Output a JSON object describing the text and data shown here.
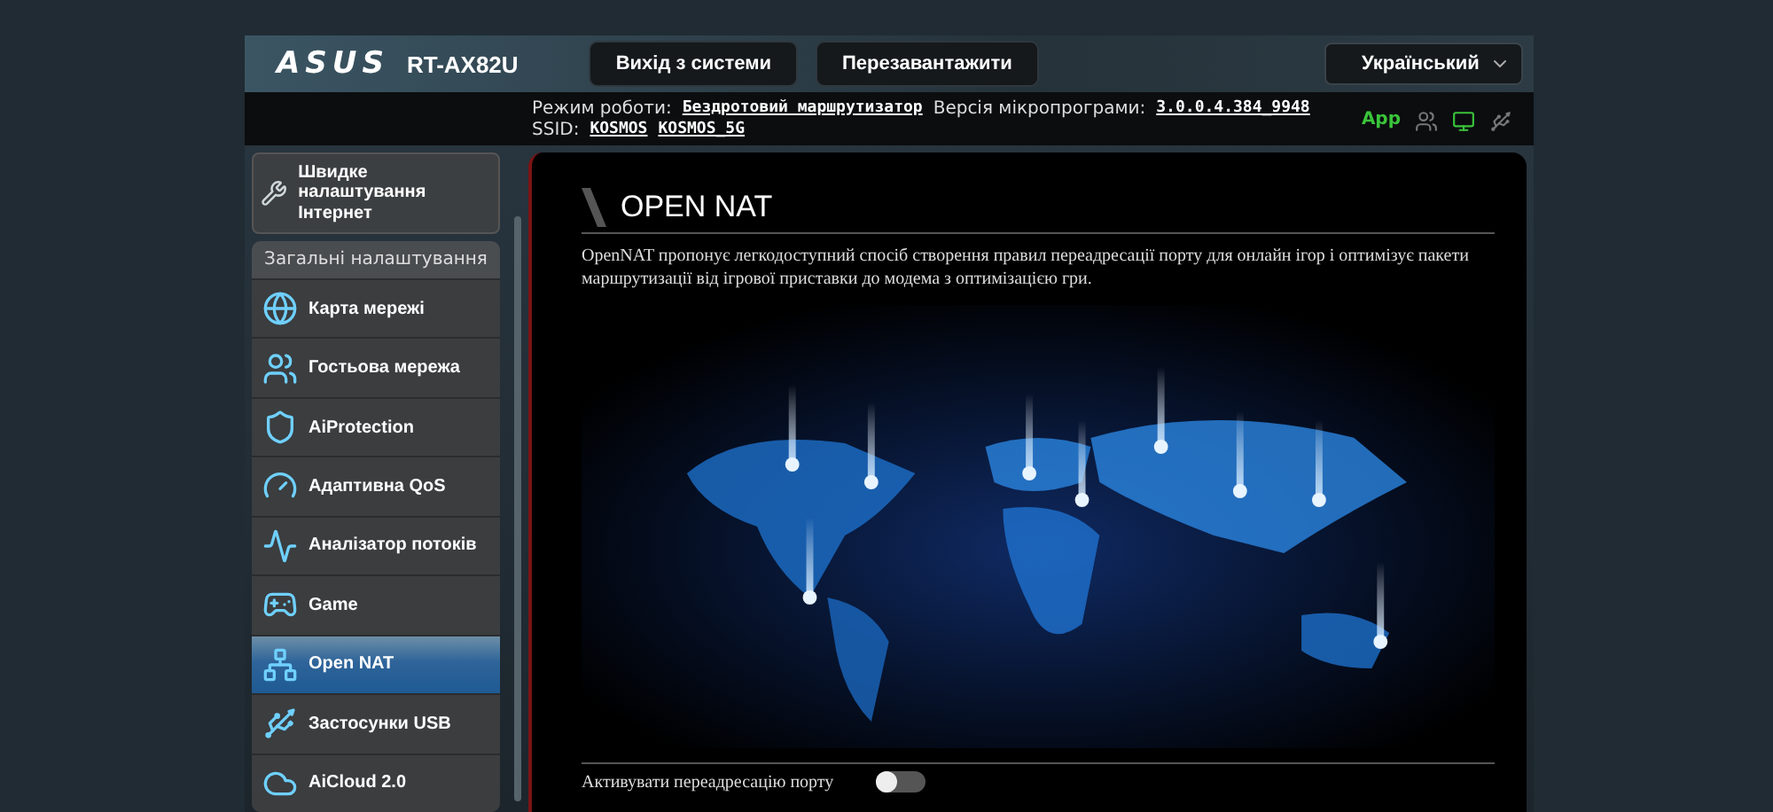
{
  "header": {
    "logo": "ASUS",
    "model": "RT-AX82U",
    "buttons": [
      "Вихід з системи",
      "Перезавантажити"
    ],
    "language": "Український"
  },
  "info": {
    "mode_label": "Режим роботи:",
    "mode": "Бездротовий маршрутизатор",
    "firmware_label": "Версія мікропрограми:",
    "firmware": "3.0.0.4.384_9948",
    "ssid_label": "SSID:",
    "ssids": [
      "KOSMOS",
      "KOSMOS_5G"
    ],
    "app": "App"
  },
  "sidebar": {
    "quick_setup": "Швидке налаштування Інтернет",
    "section": "Загальні налаштування",
    "items": [
      {
        "label": "Карта мережі",
        "selected": false
      },
      {
        "label": "Гостьова мережа",
        "selected": false
      },
      {
        "label": "AiProtection",
        "selected": false
      },
      {
        "label": "Адаптивна QoS",
        "selected": false
      },
      {
        "label": "Аналізатор потоків",
        "selected": false
      },
      {
        "label": "Game",
        "selected": false
      },
      {
        "label": "Open NAT",
        "selected": true
      },
      {
        "label": "Застосунки USB",
        "selected": false
      },
      {
        "label": "AiCloud 2.0",
        "selected": false
      }
    ]
  },
  "content": {
    "title": "OPEN NAT",
    "description": "OpenNAT пропонує легкодоступний спосіб створення правил переадресації порту для онлайн ігор і оптимізує пакети маршрутизації від ігрової приставки до модема з оптимізацією гри.",
    "setting": {
      "label": "Активувати переадресацію порту",
      "on": false
    }
  }
}
